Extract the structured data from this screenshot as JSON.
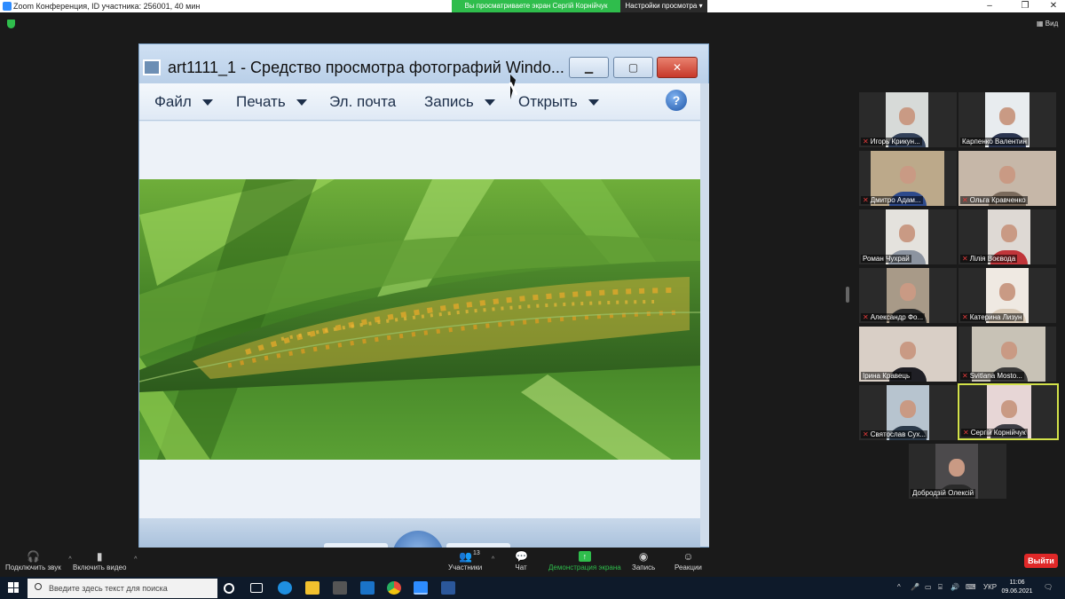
{
  "titlebar": {
    "title": "Zoom Конференция, ID участника: 256001, 40 мин",
    "share_banner": "Вы просматриваете экран Сергій Корнійчук",
    "view_settings": "Настройки просмотра"
  },
  "view_button": "Вид",
  "photo_window": {
    "title": "art1111_1 - Средство просмотра фотографий Windo...",
    "menu": [
      "Файл",
      "Печать",
      "Эл. почта",
      "Запись",
      "Открыть"
    ],
    "help": "?"
  },
  "participants": [
    {
      "name": "Игорь Крикун...",
      "muted": true
    },
    {
      "name": "Карпенко Валентин",
      "muted": false
    },
    {
      "name": "Дмитро  Адам...",
      "muted": true
    },
    {
      "name": "Ольга Кравченко",
      "muted": true
    },
    {
      "name": "Роман Чухрай",
      "muted": false
    },
    {
      "name": "Лілія Воєвода",
      "muted": true
    },
    {
      "name": "Александр Фо...",
      "muted": true
    },
    {
      "name": "Катерина Лизун",
      "muted": true
    },
    {
      "name": "Ірина Кравець",
      "muted": false
    },
    {
      "name": "Svitlana Mosto...",
      "muted": true
    },
    {
      "name": "Святослав Сух...",
      "muted": true
    },
    {
      "name": "Сергій Корнійчук",
      "muted": true
    },
    {
      "name": "Добродзій Олексій",
      "muted": false
    }
  ],
  "toolbar": {
    "audio": "Подключить звук",
    "video": "Включить видео",
    "participants": "Участники",
    "participants_count": "13",
    "chat": "Чат",
    "share": "Демонстрация экрана",
    "record": "Запись",
    "reactions": "Реакции",
    "exit": "Выйти"
  },
  "taskbar": {
    "search_placeholder": "Введите здесь текст для поиска",
    "language": "УКР",
    "time": "11:06",
    "date": "09.06.2021"
  },
  "colors": {
    "zoom_green": "#2fbd4c",
    "exit_red": "#e02828",
    "active_speaker": "#d3e24a"
  }
}
